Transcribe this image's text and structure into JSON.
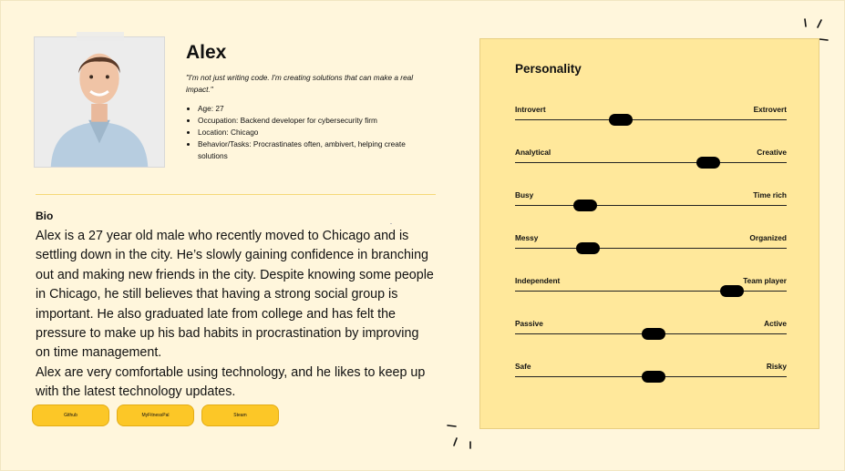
{
  "persona": {
    "name": "Alex",
    "quote": "\"I'm not just writing code. I'm creating solutions that can make a real impact.\"",
    "facts": [
      "Age: 27",
      "Occupation: Backend developer for cybersecurity firm",
      "Location: Chicago",
      "Behavior/Tasks: Procrastinates often, ambivert, helping create solutions"
    ],
    "photo": "portrait-photo"
  },
  "bio": {
    "title": "Bio",
    "paragraphs": [
      "Alex is a 27 year old male who recently moved to Chicago and is settling down in the city. He’s slowly gaining confidence in branching out and making new friends in the city. Despite knowing some people in Chicago, he still believes that having a strong social group is important. He also graduated late from college and has felt the pressure to make up his bad habits in procrastination by improving on time management.",
      "Alex are very comfortable using technology, and he likes to keep up with the latest technology updates."
    ]
  },
  "links": [
    "Github",
    "MyFitnessPal",
    "Steam"
  ],
  "personality": {
    "title": "Personality",
    "traits": [
      {
        "left": "Introvert",
        "right": "Extrovert",
        "value": 0.39
      },
      {
        "left": "Analytical",
        "right": "Creative",
        "value": 0.71
      },
      {
        "left": "Busy",
        "right": "Time rich",
        "value": 0.26
      },
      {
        "left": "Messy",
        "right": "Organized",
        "value": 0.27
      },
      {
        "left": "Independent",
        "right": "Team player",
        "value": 0.8
      },
      {
        "left": "Passive",
        "right": "Active",
        "value": 0.51
      },
      {
        "left": "Safe",
        "right": "Risky",
        "value": 0.51
      }
    ]
  },
  "colors": {
    "background": "#fff6dc",
    "panel": "#ffe89b",
    "button": "#fcc727",
    "knob": "#000000",
    "divider": "#f6d878"
  }
}
